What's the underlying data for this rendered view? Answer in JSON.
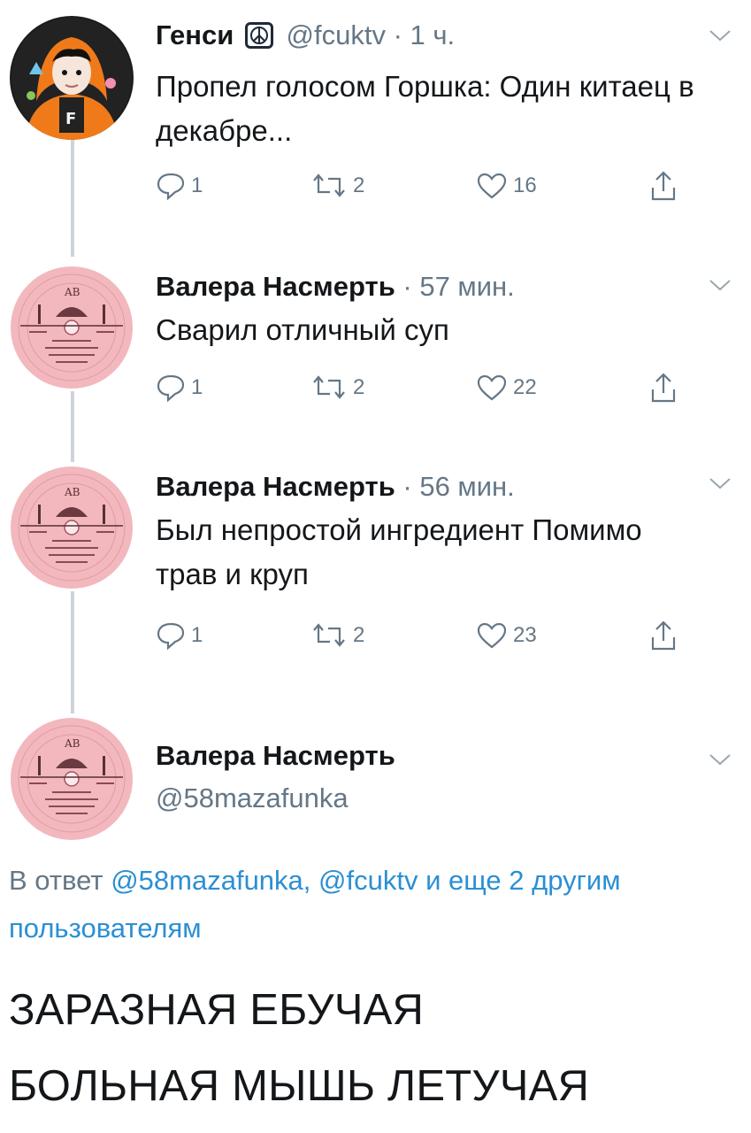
{
  "tweets": [
    {
      "name": "Генси",
      "handle": "@fcuktv",
      "separator": " · ",
      "time": "1 ч.",
      "text": "Пропел голосом Горшка: Один китаец в декабре...",
      "replies": "1",
      "retweets": "2",
      "likes": "16",
      "badge_icon": "peace-icon"
    },
    {
      "name": "Валера Насмерть",
      "separator": " · ",
      "time": "57 мин.",
      "text": "Сварил отличный суп",
      "replies": "1",
      "retweets": "2",
      "likes": "22"
    },
    {
      "name": "Валера Насмерть",
      "separator": " · ",
      "time": "56 мин.",
      "text": "Был непростой ингредиент Помимо трав и круп",
      "replies": "1",
      "retweets": "2",
      "likes": "23"
    }
  ],
  "main_tweet": {
    "name": "Валера Насмерть",
    "handle": "@58mazafunka",
    "reply_prefix": "В ответ",
    "reply_handle_1": "@58mazafunka,",
    "reply_handle_2": "@fcuktv",
    "reply_more": "и еще 2 другим пользователям",
    "text_line_1": "ЗАРАЗНАЯ ЕБУЧАЯ",
    "text_line_2": "БОЛЬНАЯ МЫШЬ ЛЕТУЧАЯ"
  },
  "colors": {
    "text": "#14171a",
    "secondary": "#657786",
    "link": "#2b8fd4",
    "thread_line": "#cdd3d8",
    "record_pink": "#f2b8be"
  }
}
